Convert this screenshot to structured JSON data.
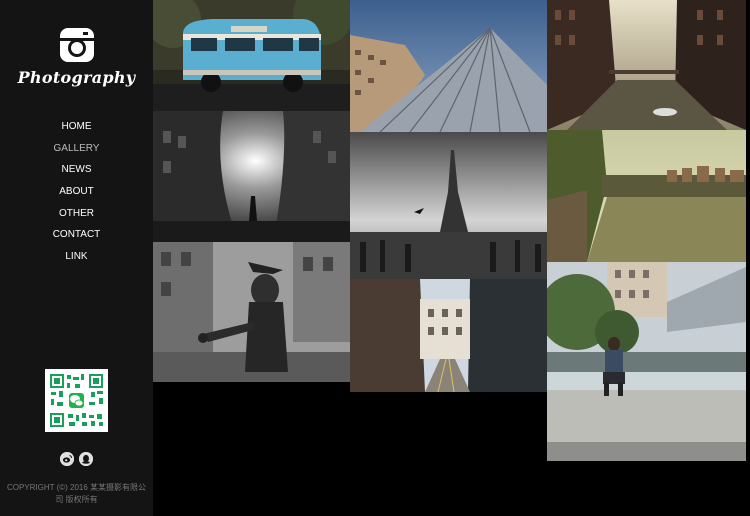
{
  "sidebar": {
    "logo_icon": "camera-icon",
    "brand": "Photography",
    "nav": [
      {
        "label": "HOME"
      },
      {
        "label": "GALLERY"
      },
      {
        "label": "NEWS"
      },
      {
        "label": "ABOUT"
      },
      {
        "label": "OTHER"
      },
      {
        "label": "CONTACT"
      },
      {
        "label": "LINK"
      }
    ],
    "active_nav": "GALLERY",
    "qr_icon": "qr-code-icon",
    "social": [
      "weibo-icon",
      "qq-icon"
    ],
    "copyright": "COPYRIGHT (©) 2016 某某摄影有限公司 版权所有"
  },
  "gallery": {
    "photos": [
      {
        "name": "photo-blue-van"
      },
      {
        "name": "photo-skyscraper"
      },
      {
        "name": "photo-canal-buildings"
      },
      {
        "name": "photo-curved-street"
      },
      {
        "name": "photo-eiffel-tower"
      },
      {
        "name": "photo-river-town"
      },
      {
        "name": "photo-bronze-statue"
      },
      {
        "name": "photo-narrow-street"
      },
      {
        "name": "photo-man-by-river"
      }
    ]
  }
}
